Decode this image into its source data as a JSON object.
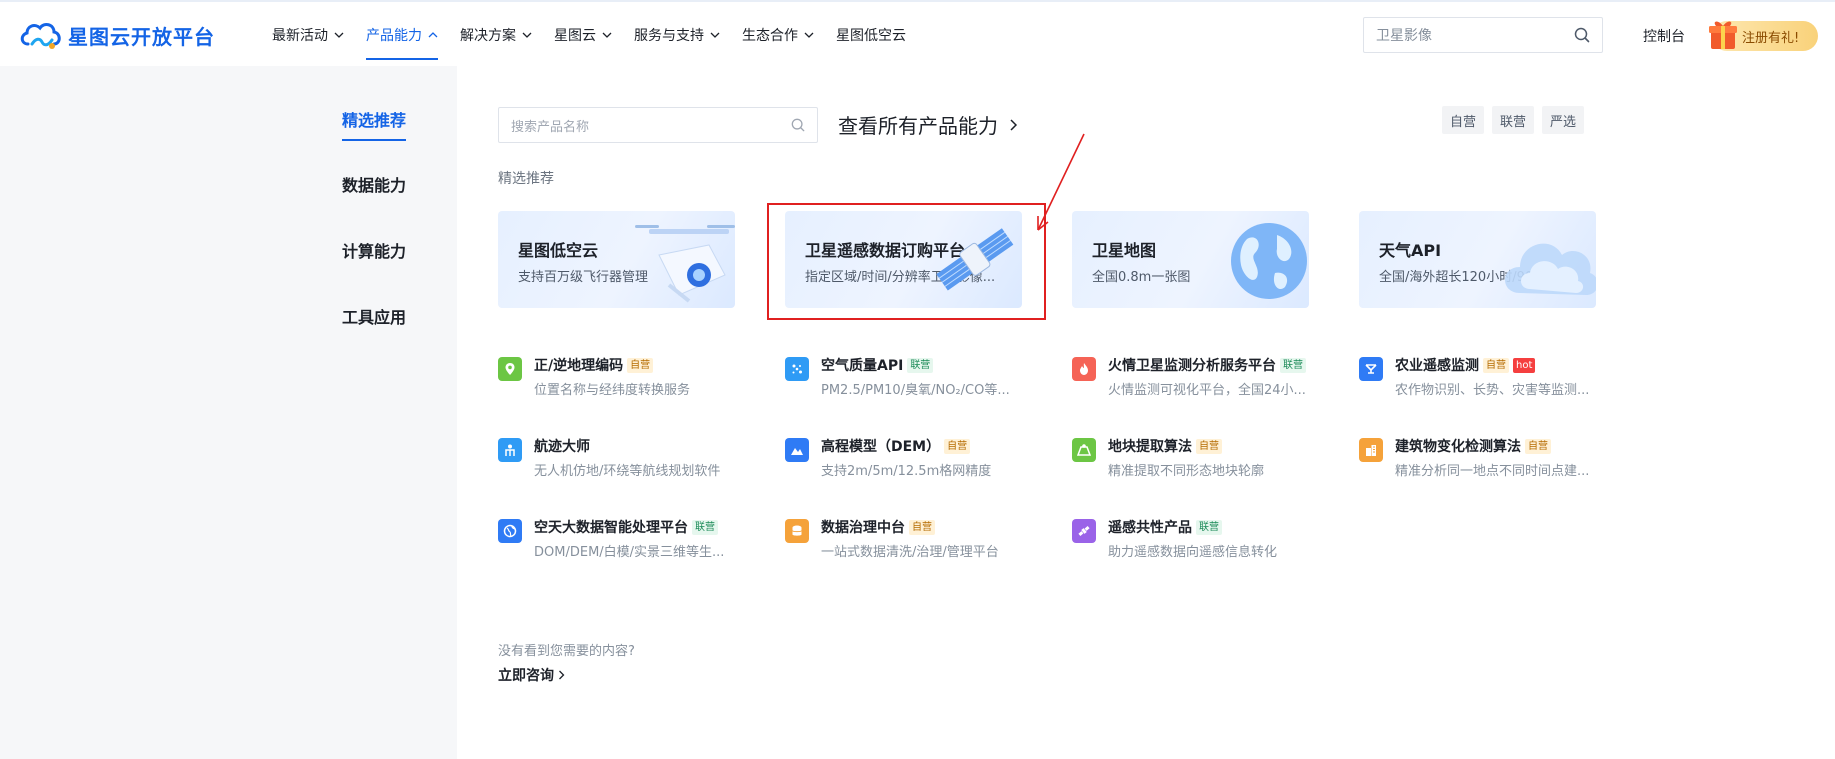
{
  "brand": {
    "name": "星图云开放平台",
    "color": "#1464e6"
  },
  "nav": [
    {
      "label": "最新活动",
      "chevron": true,
      "active": false
    },
    {
      "label": "产品能力",
      "chevron": true,
      "active": true
    },
    {
      "label": "解决方案",
      "chevron": true,
      "active": false
    },
    {
      "label": "星图云",
      "chevron": true,
      "active": false
    },
    {
      "label": "服务与支持",
      "chevron": true,
      "active": false
    },
    {
      "label": "生态合作",
      "chevron": true,
      "active": false
    },
    {
      "label": "星图低空云",
      "chevron": false,
      "active": false
    }
  ],
  "header": {
    "search_placeholder": "卫星影像",
    "console_label": "控制台",
    "register_label": "注册有礼!"
  },
  "sidebar": {
    "items": [
      {
        "label": "精选推荐",
        "active": true
      },
      {
        "label": "数据能力",
        "active": false
      },
      {
        "label": "计算能力",
        "active": false
      },
      {
        "label": "工具应用",
        "active": false
      }
    ]
  },
  "main": {
    "search_placeholder": "搜索产品名称",
    "view_all": "查看所有产品能力",
    "filters": [
      "自营",
      "联营",
      "严选"
    ],
    "section_title": "精选推荐",
    "featured": [
      {
        "title": "星图低空云",
        "desc": "支持百万级飞行器管理",
        "art": "drone"
      },
      {
        "title": "卫星遥感数据订购平台",
        "desc": "指定区域/时间/分辨率卫星影像...",
        "art": "satellite",
        "highlighted": true
      },
      {
        "title": "卫星地图",
        "desc": "全国0.8m一张图",
        "art": "globe"
      },
      {
        "title": "天气API",
        "desc": "全国/海外超长120小时/90天预报",
        "art": "cloud"
      }
    ],
    "products": [
      {
        "title": "正/逆地理编码",
        "tag": "自营",
        "tag_type": "self",
        "desc": "位置名称与经纬度转换服务",
        "icon": "location-pin-icon",
        "color": "#6cc644"
      },
      {
        "title": "空气质量API",
        "tag": "联营",
        "tag_type": "joint",
        "desc": "PM2.5/PM10/臭氧/NO₂/CO等...",
        "icon": "air-dots-icon",
        "color": "#2f9bf5"
      },
      {
        "title": "火情卫星监测分析服务平台",
        "tag": "联营",
        "tag_type": "joint",
        "desc": "火情监测可视化平台，全国24小...",
        "icon": "fire-icon",
        "color": "#f56356"
      },
      {
        "title": "农业遥感监测",
        "tag": "自营",
        "tag_type": "self",
        "tag2": "hot",
        "desc": "农作物识别、长势、灾害等监测...",
        "icon": "farm-icon",
        "color": "#2f7bf5"
      },
      {
        "title": "航迹大师",
        "tag": "",
        "tag_type": "",
        "desc": "无人机仿地/环绕等航线规划软件",
        "icon": "route-icon",
        "color": "#2f9bf5"
      },
      {
        "title": "高程模型（DEM）",
        "tag": "自营",
        "tag_type": "self",
        "desc": "支持2m/5m/12.5m格网精度",
        "icon": "mountain-icon",
        "color": "#2f7bf5"
      },
      {
        "title": "地块提取算法",
        "tag": "自营",
        "tag_type": "self",
        "desc": "精准提取不同形态地块轮廓",
        "icon": "land-plot-icon",
        "color": "#6cc644"
      },
      {
        "title": "建筑物变化检测算法",
        "tag": "自营",
        "tag_type": "self",
        "desc": "精准分析同一地点不同时间点建...",
        "icon": "building-icon",
        "color": "#f5a23a"
      },
      {
        "title": "空天大数据智能处理平台",
        "tag": "联营",
        "tag_type": "joint",
        "desc": "DOM/DEM/白模/实景三维等生...",
        "icon": "globe-icon",
        "color": "#2f7bf5"
      },
      {
        "title": "数据治理中台",
        "tag": "自营",
        "tag_type": "self",
        "desc": "一站式数据清洗/治理/管理平台",
        "icon": "database-icon",
        "color": "#f5a23a"
      },
      {
        "title": "遥感共性产品",
        "tag": "联营",
        "tag_type": "joint",
        "desc": "助力遥感数据向遥感信息转化",
        "icon": "satellite-icon",
        "color": "#9a63e8"
      }
    ],
    "footer_question": "没有看到您需要的内容?",
    "footer_link": "立即咨询"
  }
}
